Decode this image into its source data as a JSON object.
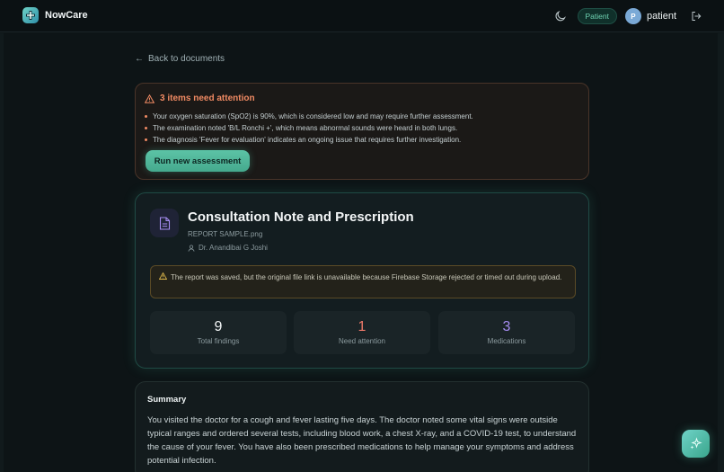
{
  "app": {
    "brand": "NowCare",
    "role_badge": "Patient",
    "avatar_initial": "P",
    "user_name": "patient"
  },
  "nav": {
    "back_label": "Back to documents"
  },
  "alert": {
    "title": "3 items need attention",
    "items": [
      "Your oxygen saturation (SpO2) is 90%, which is considered low and may require further assessment.",
      "The examination noted 'B/L Ronchi +', which means abnormal sounds were heard in both lungs.",
      "The diagnosis 'Fever for evaluation' indicates an ongoing issue that requires further investigation."
    ],
    "button_label": "Run new assessment",
    "color": "#f08a63"
  },
  "document": {
    "title": "Consultation Note and Prescription",
    "file_name": "REPORT SAMPLE.png",
    "doctor": "Dr. Anandibai G Joshi",
    "storage_warning": "The report was saved, but the original file link is unavailable because Firebase Storage rejected or timed out during upload."
  },
  "stats": [
    {
      "value": "9",
      "label": "Total findings",
      "color": "#f3f6f7"
    },
    {
      "value": "1",
      "label": "Need attention",
      "color": "#ef7a6a"
    },
    {
      "value": "3",
      "label": "Medications",
      "color": "#a58cf0"
    }
  ],
  "summary": {
    "title": "Summary",
    "text": "You visited the doctor for a cough and fever lasting five days. The doctor noted some vital signs were outside typical ranges and ordered several tests, including blood work, a chest X-ray, and a COVID-19 test, to understand the cause of your fever. You have also been prescribed medications to help manage your symptoms and address potential infection."
  },
  "icons": {
    "logo": "medical-cross-icon",
    "theme": "moon-icon",
    "logout": "logout-icon",
    "back": "arrow-left-icon",
    "alert": "warning-triangle-icon",
    "document": "document-icon",
    "doctor": "user-icon",
    "fab": "sparkles-icon"
  },
  "colors": {
    "accent": "#5cc3a6",
    "background": "#0d1416"
  }
}
